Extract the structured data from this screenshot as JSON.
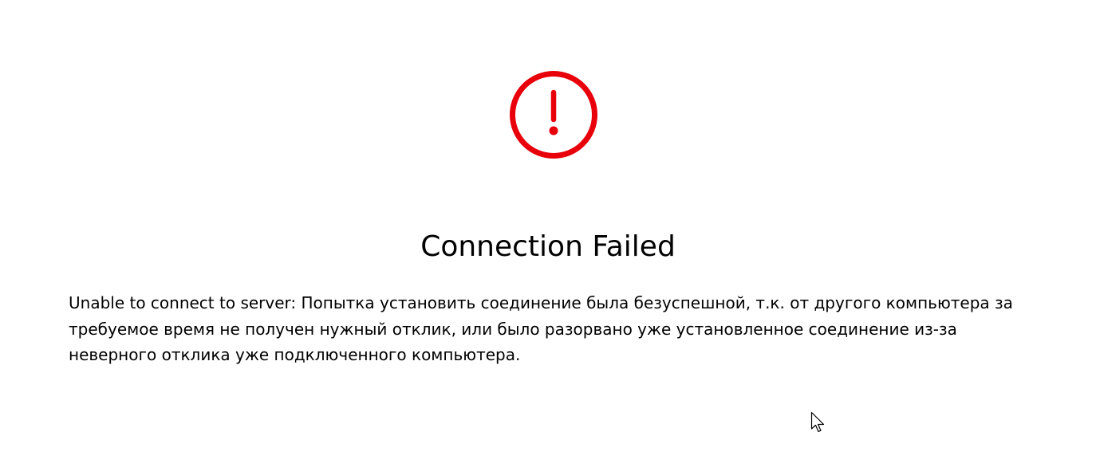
{
  "dialog": {
    "icon": "error-exclamation-icon",
    "icon_color": "#e8000b",
    "title": "Connection Failed",
    "message": "Unable to connect to server: Попытка установить соединение была безуспешной, т.к. от другого компьютера за требуемое время не получен нужный отклик, или было разорвано уже установленное соединение из-за неверного отклика уже подключенного компьютера."
  },
  "cursor": {
    "icon": "mouse-pointer-icon"
  }
}
